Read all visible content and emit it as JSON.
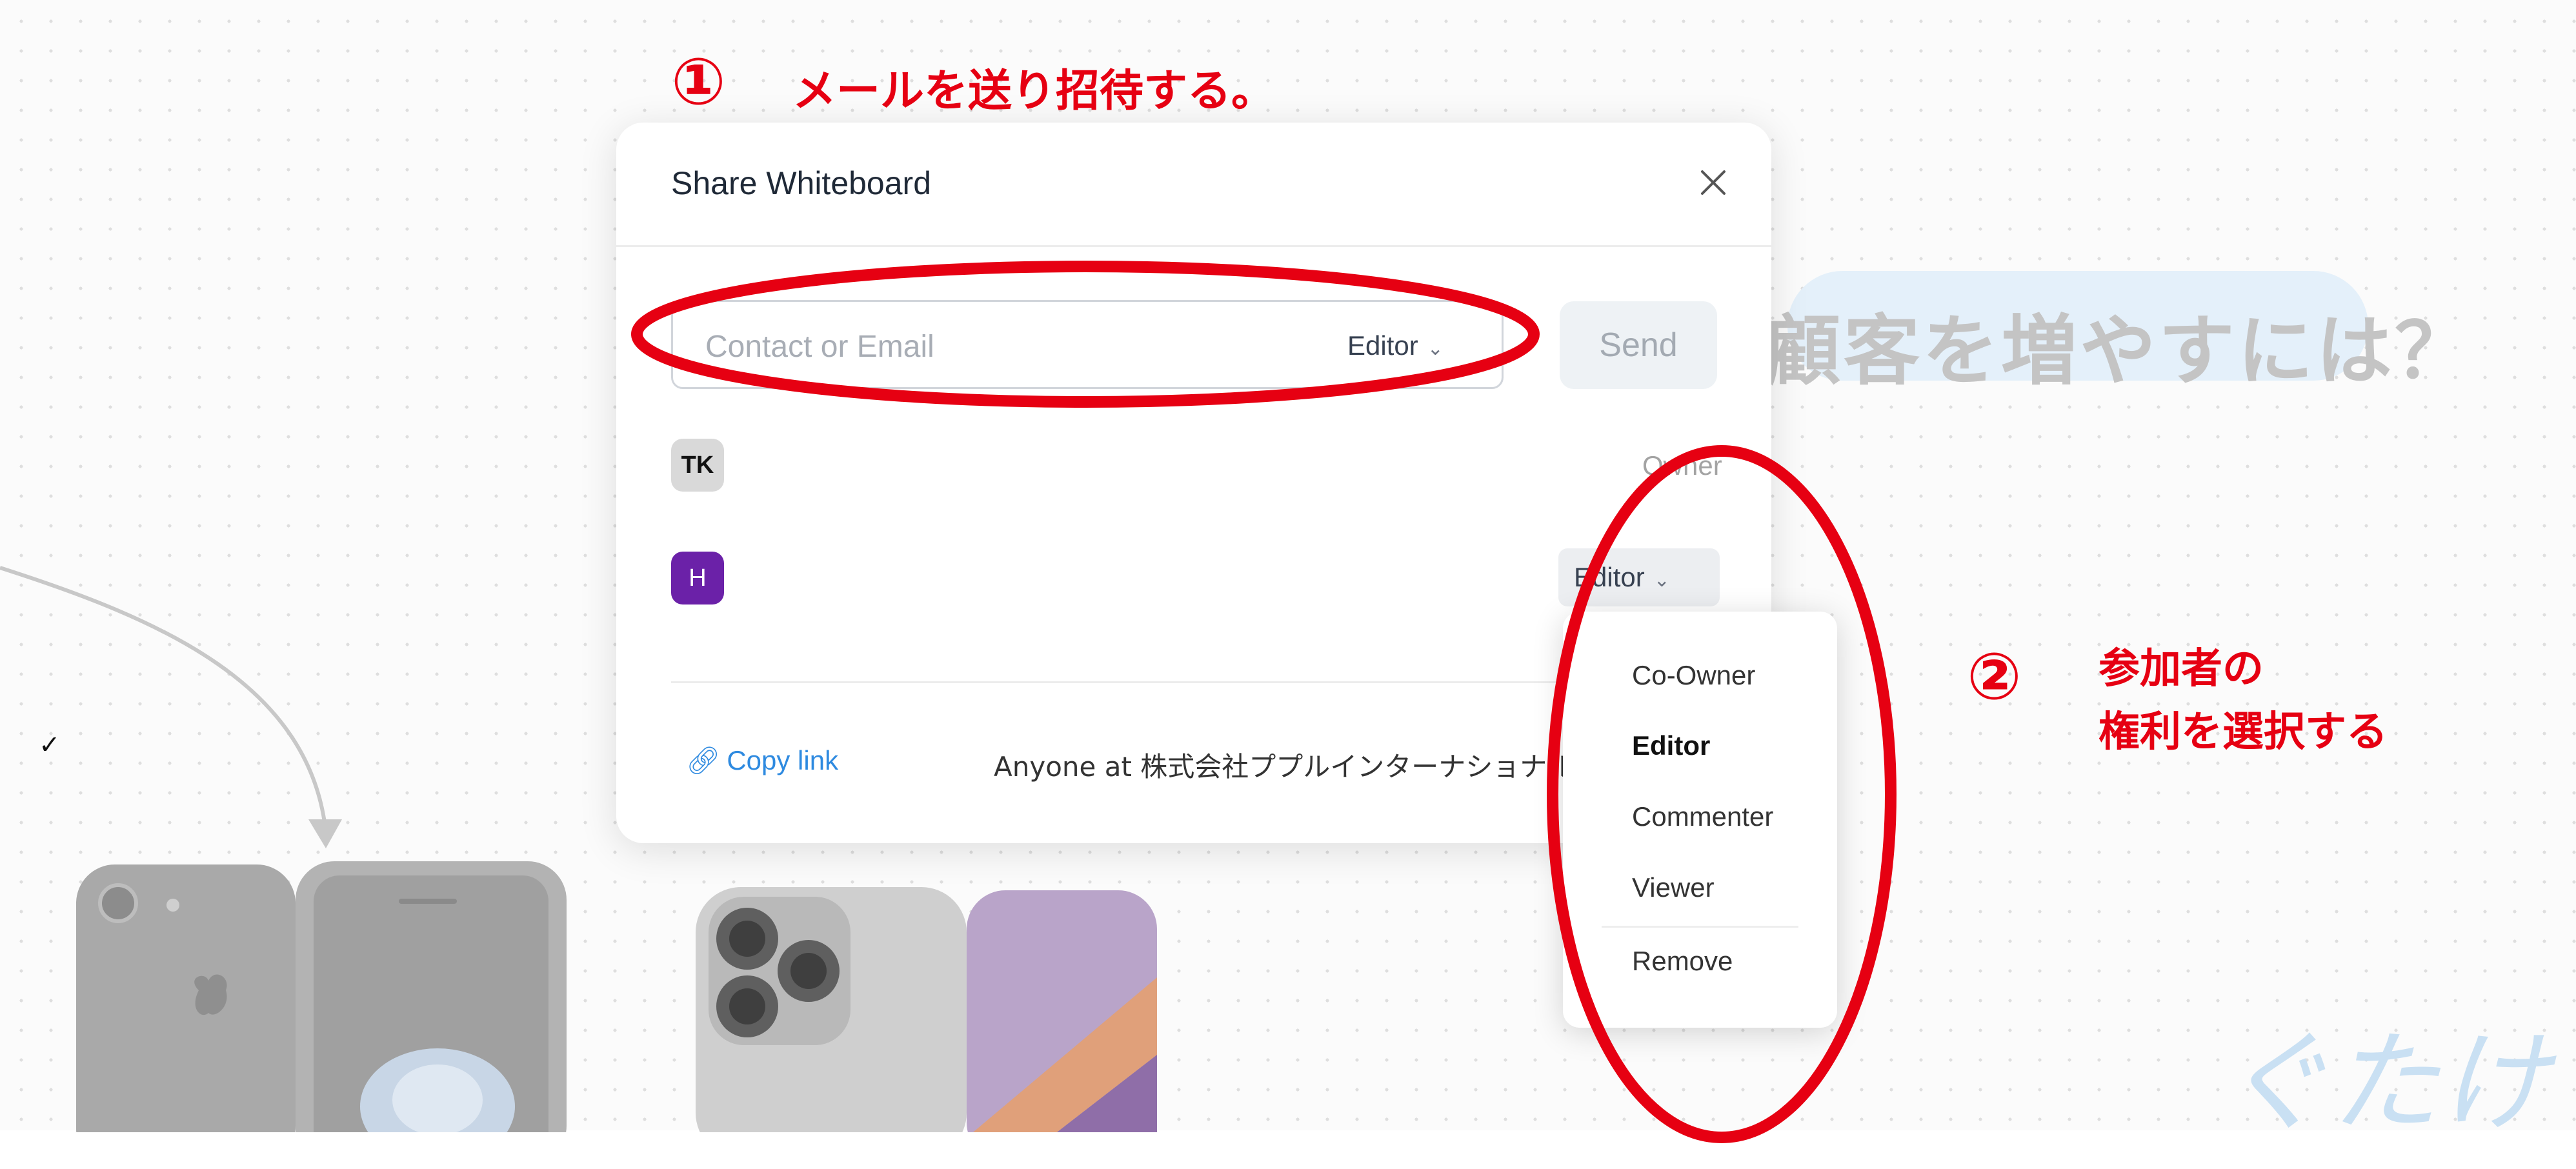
{
  "dialog": {
    "title": "Share Whiteboard",
    "contact_placeholder": "Contact or Email",
    "invite_role": "Editor",
    "send_label": "Send",
    "members": [
      {
        "initials": "TK",
        "role": "Owner"
      },
      {
        "initials": "H",
        "role": "Editor"
      }
    ],
    "copy_link_label": "Copy link",
    "anyone_text": "Anyone at 株式会社ププルインターナショナル"
  },
  "role_menu": {
    "items": [
      "Co-Owner",
      "Editor",
      "Commenter",
      "Viewer"
    ],
    "selected": "Editor",
    "remove_label": "Remove"
  },
  "background": {
    "heading": "顧客を増やすには？",
    "script_text": "ぐたけ"
  },
  "annotations": {
    "step1_number": "①",
    "step1_text": "メールを送り招待する。",
    "step2_number": "②",
    "step2_line1": "参加者の",
    "step2_line2": "権利を選択する"
  },
  "colors": {
    "annotation_red": "#e60012",
    "link_blue": "#2e8ae0",
    "avatar_h_purple": "#6b21a8"
  }
}
